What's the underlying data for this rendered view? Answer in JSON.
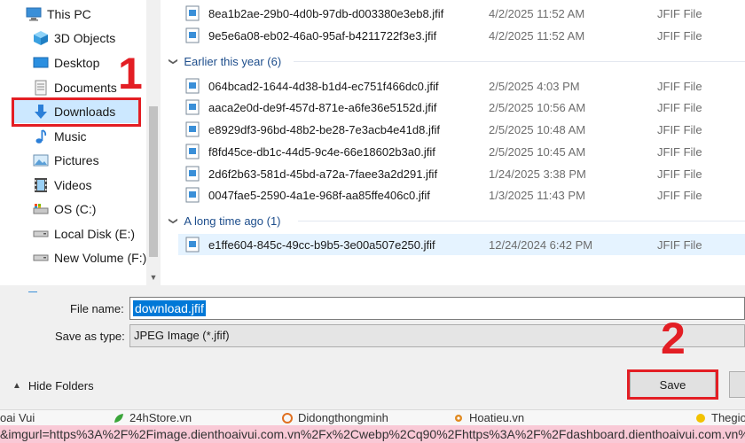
{
  "nav": {
    "items": [
      {
        "label": "This PC",
        "icon": "computer-icon"
      },
      {
        "label": "3D Objects",
        "icon": "cube-icon"
      },
      {
        "label": "Desktop",
        "icon": "desktop-icon"
      },
      {
        "label": "Documents",
        "icon": "document-icon"
      },
      {
        "label": "Downloads",
        "icon": "download-arrow-icon",
        "selected": true
      },
      {
        "label": "Music",
        "icon": "music-note-icon"
      },
      {
        "label": "Pictures",
        "icon": "picture-icon"
      },
      {
        "label": "Videos",
        "icon": "film-icon"
      },
      {
        "label": "OS (C:)",
        "icon": "system-drive-icon"
      },
      {
        "label": "Local Disk (E:)",
        "icon": "drive-icon"
      },
      {
        "label": "New Volume (F:)",
        "icon": "drive-icon"
      }
    ]
  },
  "filelist": {
    "top_rows": [
      {
        "name": "8ea1b2ae-29b0-4d0b-97db-d003380e3eb8.jfif",
        "date": "4/2/2025 11:52 AM",
        "type": "JFIF File"
      },
      {
        "name": "9e5e6a08-eb02-46a0-95af-b4211722f3e3.jfif",
        "date": "4/2/2025 11:52 AM",
        "type": "JFIF File"
      }
    ],
    "groups": [
      {
        "header": "Earlier this year (6)",
        "rows": [
          {
            "name": "064bcad2-1644-4d38-b1d4-ec751f466dc0.jfif",
            "date": "2/5/2025 4:03 PM",
            "type": "JFIF File"
          },
          {
            "name": "aaca2e0d-de9f-457d-871e-a6fe36e5152d.jfif",
            "date": "2/5/2025 10:56 AM",
            "type": "JFIF File"
          },
          {
            "name": "e8929df3-96bd-48b2-be28-7e3acb4e41d8.jfif",
            "date": "2/5/2025 10:48 AM",
            "type": "JFIF File"
          },
          {
            "name": "f8fd45ce-db1c-44d5-9c4e-66e18602b3a0.jfif",
            "date": "2/5/2025 10:45 AM",
            "type": "JFIF File"
          },
          {
            "name": "2d6f2b63-581d-45bd-a72a-7faee3a2d291.jfif",
            "date": "1/24/2025 3:38 PM",
            "type": "JFIF File"
          },
          {
            "name": "0047fae5-2590-4a1e-968f-aa85ffe406c0.jfif",
            "date": "1/3/2025 11:43 PM",
            "type": "JFIF File"
          }
        ]
      },
      {
        "header": "A long time ago (1)",
        "rows": [
          {
            "name": "e1ffe604-845c-49cc-b9b5-3e00a507e250.jfif",
            "date": "12/24/2024 6:42 PM",
            "type": "JFIF File",
            "selected": true
          }
        ]
      }
    ]
  },
  "form": {
    "filename_label": "File name:",
    "filename_value": "download.jfif",
    "savetype_label": "Save as type:",
    "savetype_value": "JPEG Image (*.jfif)",
    "hide_folders_label": "Hide Folders",
    "save_label": "Save"
  },
  "annotations": {
    "step1": "1",
    "step2": "2",
    "color": "#e31e24"
  },
  "bookmarks": [
    {
      "label": "oai Vui",
      "icon": "none"
    },
    {
      "label": "24hStore.vn",
      "icon": "leaf-icon"
    },
    {
      "label": "Didongthongminh",
      "icon": "circle-logo-icon"
    },
    {
      "label": "Hoatieu.vn",
      "icon": "gear-logo-icon"
    },
    {
      "label": "Thegio",
      "icon": "star-logo-icon"
    }
  ],
  "url_text": "&imgurl=https%3A%2F%2Fimage.dienthoaivui.com.vn%2Fx%2Cwebp%2Cq90%2Fhttps%3A%2F%2Fdashboard.dienthoaivui.com.vn%2Fuploa",
  "colors": {
    "selection": "#cce8ff",
    "highlight": "#0078d7",
    "group_header": "#1e4e8c"
  }
}
